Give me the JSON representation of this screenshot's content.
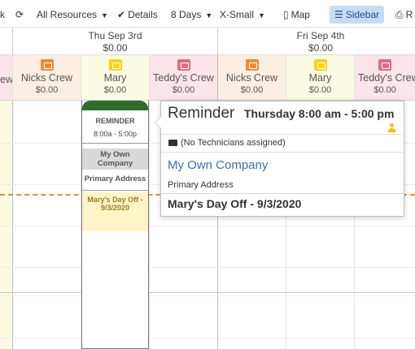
{
  "toolbar": {
    "partial_left": "k",
    "resources_label": "All Resources",
    "details_label": "Details",
    "days_label": "8 Days",
    "size_label": "X-Small",
    "map_label": "Map",
    "sidebar_label": "Sidebar",
    "print_partial": "R"
  },
  "days": [
    {
      "title": "Thu Sep 3rd",
      "amount": "$0.00"
    },
    {
      "title": "Fri Sep 4th",
      "amount": "$0.00"
    }
  ],
  "resources": {
    "partial_left": "ew",
    "thu": [
      {
        "name": "Nicks Crew",
        "amount": "$0.00",
        "color": "#f08a3c",
        "icon": "truck-icon"
      },
      {
        "name": "Mary",
        "amount": "$0.00",
        "color": "#f3d61a",
        "icon": "person-icon"
      },
      {
        "name": "Teddy's Crew",
        "amount": "$0.00",
        "color": "#e06b83",
        "icon": "truck-icon"
      }
    ],
    "fri": [
      {
        "name": "Nicks Crew",
        "amount": "$0.00",
        "color": "#f08a3c",
        "icon": "truck-icon"
      },
      {
        "name": "Mary",
        "amount": "$0.00",
        "color": "#f3d61a",
        "icon": "person-icon"
      },
      {
        "name": "Teddy's Crew",
        "amount": "$0.00",
        "color": "#e06b83",
        "icon": "truck-icon"
      }
    ]
  },
  "event": {
    "type": "REMINDER",
    "time": "8:00a - 5:00p",
    "company": "My Own Company",
    "address": "Primary Address",
    "note": "Mary's Day Off - 9/3/2020"
  },
  "popover": {
    "title": "Reminder",
    "when": "Thursday 8:00 am - 5:00 pm",
    "technicians": "(No Technicians assigned)",
    "company": "My Own Company",
    "address": "Primary Address",
    "note": "Mary's Day Off - 9/3/2020"
  },
  "colors": {
    "now_line": "#f0882e",
    "event_header": "#2f6b2a",
    "company_link": "#3d6fa9",
    "sidebar_active": "#c6dcf3"
  }
}
